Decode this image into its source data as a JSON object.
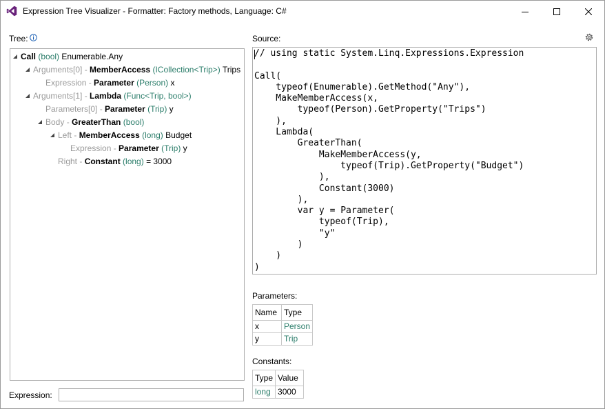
{
  "window": {
    "title": "Expression Tree Visualizer - Formatter: Factory methods, Language: C#",
    "controls": {
      "minimize": "minimize",
      "maximize": "maximize",
      "close": "close"
    }
  },
  "tree": {
    "label": "Tree:",
    "nodes": [
      {
        "prefix": "",
        "sep": "",
        "name": "Call",
        "type": "(bool)",
        "suffix": "Enumerable.Any"
      },
      {
        "prefix": "Arguments[0]",
        "sep": " - ",
        "name": "MemberAccess",
        "type": "(ICollection<Trip>)",
        "suffix": "Trips"
      },
      {
        "prefix": "Expression",
        "sep": " - ",
        "name": "Parameter",
        "type": "(Person)",
        "suffix": "x"
      },
      {
        "prefix": "Arguments[1]",
        "sep": " - ",
        "name": "Lambda",
        "type": "(Func<Trip, bool>)",
        "suffix": ""
      },
      {
        "prefix": "Parameters[0]",
        "sep": " - ",
        "name": "Parameter",
        "type": "(Trip)",
        "suffix": "y"
      },
      {
        "prefix": "Body",
        "sep": " - ",
        "name": "GreaterThan",
        "type": "(bool)",
        "suffix": ""
      },
      {
        "prefix": "Left",
        "sep": " - ",
        "name": "MemberAccess",
        "type": "(long)",
        "suffix": "Budget"
      },
      {
        "prefix": "Expression",
        "sep": " - ",
        "name": "Parameter",
        "type": "(Trip)",
        "suffix": "y"
      },
      {
        "prefix": "Right",
        "sep": " - ",
        "name": "Constant",
        "type": "(long)",
        "suffix": " = 3000"
      }
    ]
  },
  "source": {
    "label": "Source:",
    "code": "// using static System.Linq.Expressions.Expression\n\nCall(\n    typeof(Enumerable).GetMethod(\"Any\"),\n    MakeMemberAccess(x,\n        typeof(Person).GetProperty(\"Trips\")\n    ),\n    Lambda(\n        GreaterThan(\n            MakeMemberAccess(y,\n                typeof(Trip).GetProperty(\"Budget\")\n            ),\n            Constant(3000)\n        ),\n        var y = Parameter(\n            typeof(Trip),\n            \"y\"\n        )\n    )\n)"
  },
  "expression": {
    "label": "Expression:",
    "value": ""
  },
  "parameters": {
    "label": "Parameters:",
    "headers": [
      "Name",
      "Type"
    ],
    "rows": [
      {
        "name": "x",
        "type": "Person"
      },
      {
        "name": "y",
        "type": "Trip"
      }
    ]
  },
  "constants": {
    "label": "Constants:",
    "headers": [
      "Type",
      "Value"
    ],
    "rows": [
      {
        "type": "long",
        "value": "3000"
      }
    ]
  },
  "colors": {
    "type_text": "#2b7d6a",
    "prefix_text": "#9a9a9a",
    "vs_purple": "#68217a"
  }
}
